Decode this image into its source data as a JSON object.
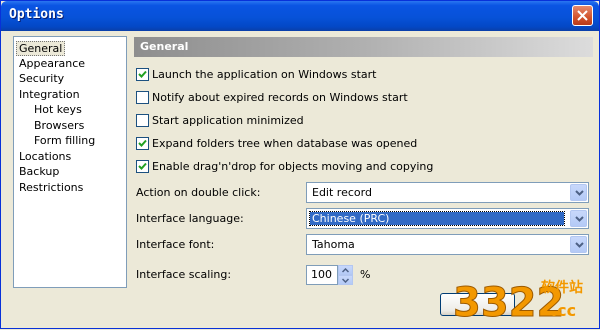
{
  "window": {
    "title": "Options"
  },
  "nav": {
    "items": [
      {
        "label": "General",
        "level": 0,
        "selected": true
      },
      {
        "label": "Appearance",
        "level": 0
      },
      {
        "label": "Security",
        "level": 0
      },
      {
        "label": "Integration",
        "level": 0
      },
      {
        "label": "Hot keys",
        "level": 1
      },
      {
        "label": "Browsers",
        "level": 1
      },
      {
        "label": "Form filling",
        "level": 1
      },
      {
        "label": "Locations",
        "level": 0
      },
      {
        "label": "Backup",
        "level": 0
      },
      {
        "label": "Restrictions",
        "level": 0
      }
    ]
  },
  "general": {
    "header": "General",
    "checkboxes": [
      {
        "label": "Launch the application on Windows start",
        "checked": true
      },
      {
        "label": "Notify about expired records on Windows start",
        "checked": false
      },
      {
        "label": "Start application minimized",
        "checked": false
      },
      {
        "label": "Expand folders tree when database was opened",
        "checked": true
      },
      {
        "label": "Enable drag'n'drop for objects moving and copying",
        "checked": true
      }
    ],
    "action_label": "Action on double click:",
    "action_value": "Edit record",
    "language_label": "Interface language:",
    "language_value": "Chinese (PRC)",
    "font_label": "Interface font:",
    "font_value": "Tahoma",
    "scaling_label": "Interface scaling:",
    "scaling_value": "100",
    "scaling_unit": "%"
  },
  "watermark": {
    "number": "3322",
    "text": "软件站",
    "domain": ".cc"
  },
  "colors": {
    "title_bar": "#0a54e3",
    "selection": "#316ac5",
    "close": "#d2532c",
    "watermark_orange": "#f39800"
  }
}
